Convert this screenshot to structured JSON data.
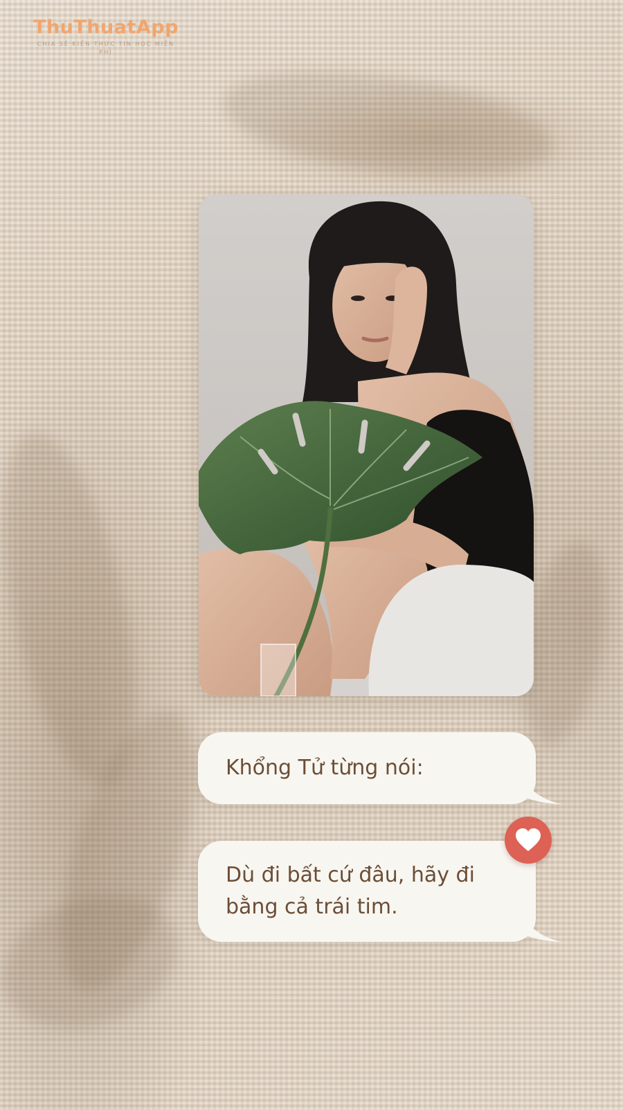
{
  "brand": {
    "logo_text": "ThuThuatApp",
    "tagline": "CHIA SẺ KIẾN THỨC TIN HỌC MIỄN PHÍ"
  },
  "photo": {
    "subject": "Woman with dark hair holding a monstera leaf"
  },
  "messages": [
    {
      "text": "Khổng Tử từng nói:"
    },
    {
      "text": "Dù đi bất cứ đâu, hãy đi bằng cả trái tim."
    }
  ],
  "reaction": {
    "icon": "heart-icon",
    "color": "#dd6155"
  },
  "colors": {
    "background": "#e3d6c6",
    "bubble": "#f8f6f1",
    "text": "#6b4e36",
    "logo": "#f0a66e"
  }
}
